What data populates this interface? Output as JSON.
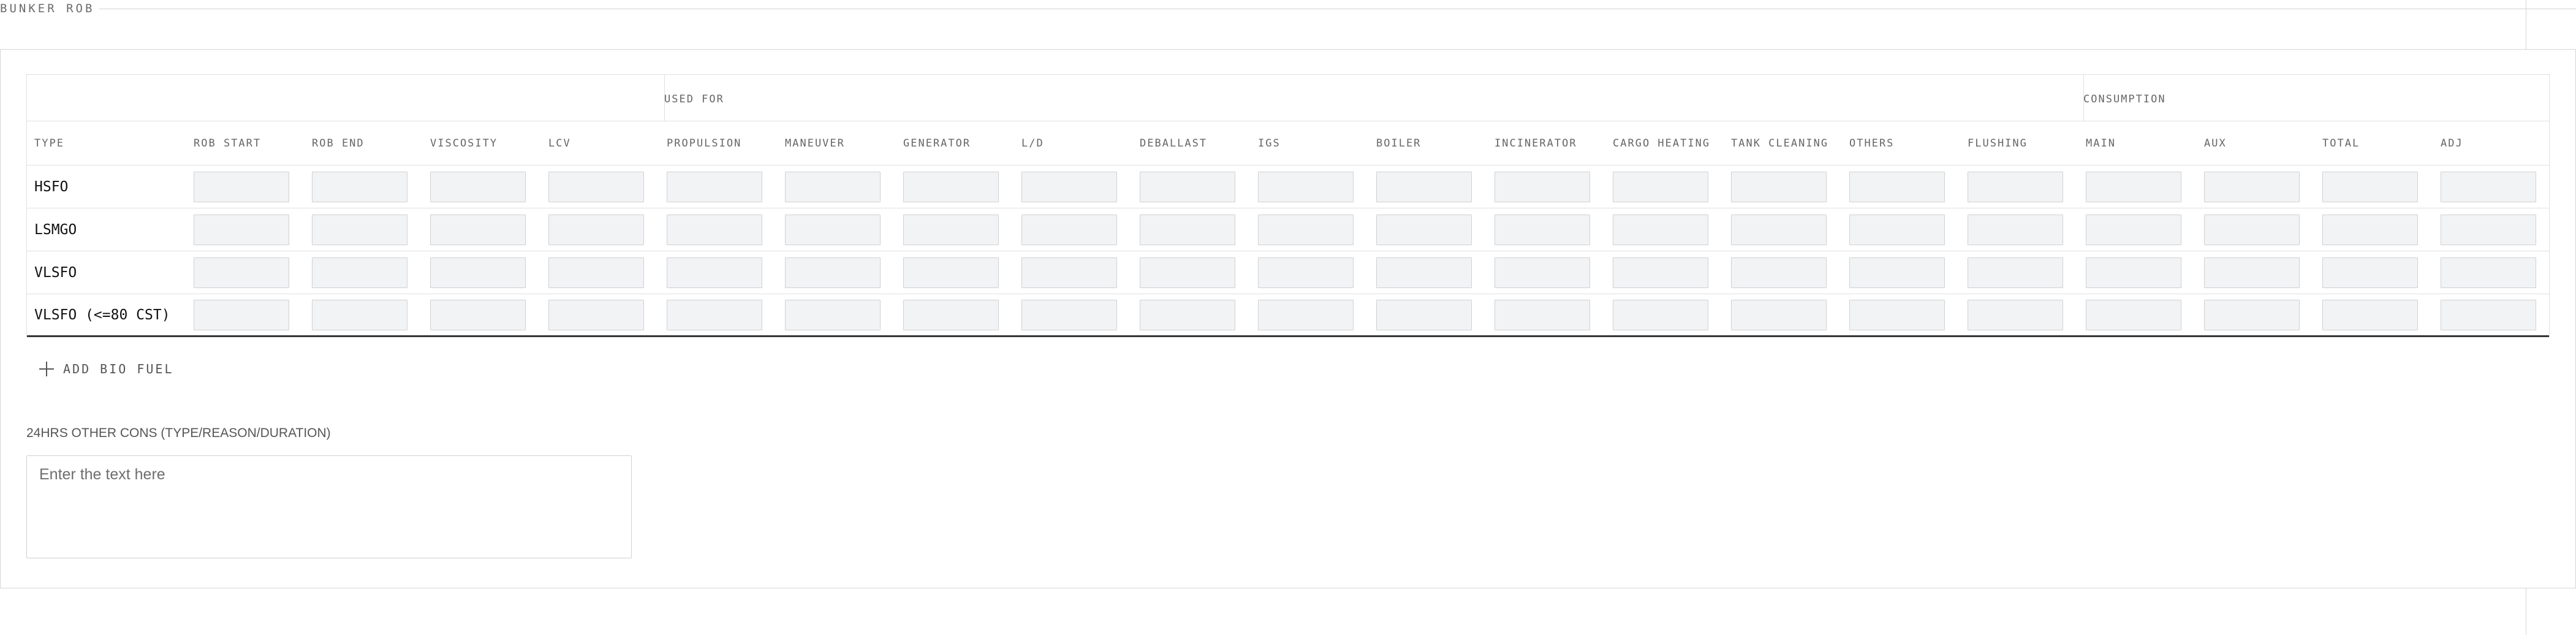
{
  "section": {
    "title": "BUNKER ROB"
  },
  "table": {
    "group_used_for": "USED FOR",
    "group_consumption": "CONSUMPTION",
    "headers": {
      "type": "TYPE",
      "rob_start": "ROB START",
      "rob_end": "ROB END",
      "viscosity": "VISCOSITY",
      "lcv": "LCV",
      "propulsion": "PROPULSION",
      "maneuver": "MANEUVER",
      "generator": "GENERATOR",
      "ld": "L/D",
      "deballast": "DEBALLAST",
      "igs": "IGS",
      "boiler": "BOILER",
      "incinerator": "INCINERATOR",
      "cargo_heating": "CARGO HEATING",
      "tank_cleaning": "TANK CLEANING",
      "others": "OTHERS",
      "flushing": "FLUSHING",
      "main": "MAIN",
      "aux": "AUX",
      "total": "TOTAL",
      "adj": "ADJ"
    },
    "rows": [
      {
        "type": "HSFO"
      },
      {
        "type": "LSMGO"
      },
      {
        "type": "VLSFO"
      },
      {
        "type": "VLSFO (<=80 CST)"
      }
    ]
  },
  "add_bio_fuel": {
    "label": "ADD BIO FUEL"
  },
  "other_cons": {
    "label": "24HRS OTHER CONS (TYPE/REASON/DURATION)",
    "placeholder": "Enter the text here",
    "value": ""
  }
}
